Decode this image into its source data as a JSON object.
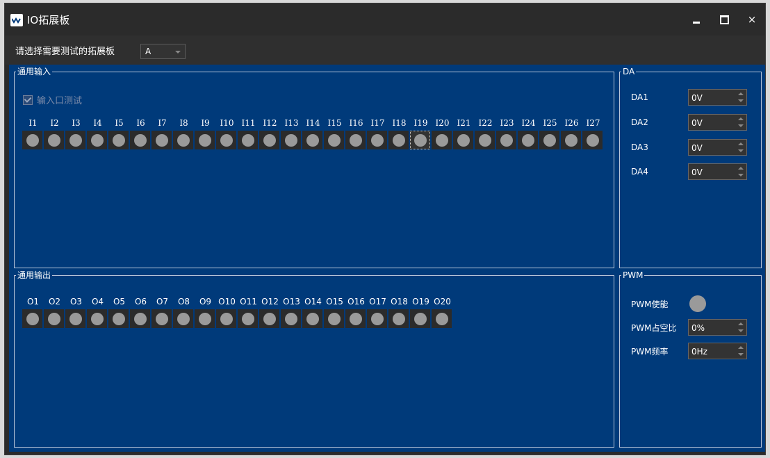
{
  "window": {
    "title": "IO拓展板",
    "controls": {
      "minimize": "—",
      "maximize": "☐",
      "close": "×"
    }
  },
  "board_select": {
    "label": "请选择需要测试的拓展板",
    "value": "A"
  },
  "inputs": {
    "title": "通用输入",
    "checkbox_label": "输入口测试",
    "checkbox_checked": true,
    "labels": [
      "I1",
      "I2",
      "I3",
      "I4",
      "I5",
      "I6",
      "I7",
      "I8",
      "I9",
      "I10",
      "I11",
      "I12",
      "I13",
      "I14",
      "I15",
      "I16",
      "I17",
      "I18",
      "I19",
      "I20",
      "I21",
      "I22",
      "I23",
      "I24",
      "I25",
      "I26",
      "I27"
    ],
    "focused_index": 18
  },
  "outputs": {
    "title": "通用输出",
    "labels": [
      "O1",
      "O2",
      "O3",
      "O4",
      "O5",
      "O6",
      "O7",
      "O8",
      "O9",
      "O10",
      "O11",
      "O12",
      "O13",
      "O14",
      "O15",
      "O16",
      "O17",
      "O18",
      "O19",
      "O20"
    ]
  },
  "da": {
    "title": "DA",
    "fields": [
      {
        "label": "DA1",
        "value": "0V"
      },
      {
        "label": "DA2",
        "value": "0V"
      },
      {
        "label": "DA3",
        "value": "0V"
      },
      {
        "label": "DA4",
        "value": "0V"
      }
    ]
  },
  "pwm": {
    "title": "PWM",
    "enable_label": "PWM使能",
    "duty_label": "PWM占空比",
    "duty_value": "0%",
    "freq_label": "PWM频率",
    "freq_value": "0Hz"
  },
  "colors": {
    "panel_bg": "#003a7a",
    "led_off": "#9a9a9a",
    "window_bg": "#2b2b2b"
  }
}
